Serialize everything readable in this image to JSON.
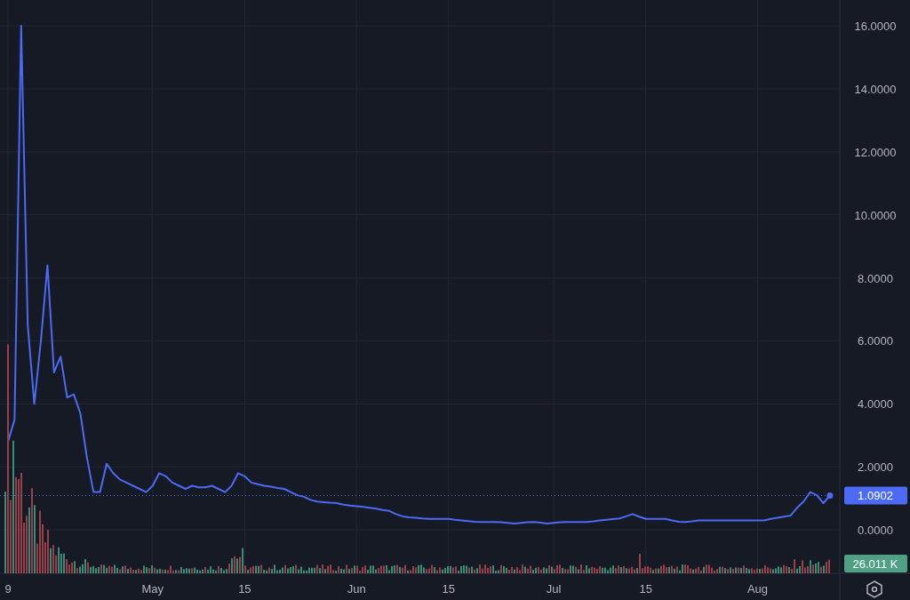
{
  "chart": {
    "chart_data": {
      "type": "line",
      "grid": true,
      "ylim": [
        -1.38,
        16.82
      ],
      "categories": [
        "9",
        null,
        null,
        null,
        null,
        null,
        null,
        null,
        null,
        null,
        null,
        null,
        null,
        null,
        null,
        null,
        null,
        null,
        null,
        null,
        null,
        null,
        "May",
        null,
        null,
        null,
        null,
        null,
        null,
        null,
        null,
        null,
        null,
        null,
        null,
        null,
        "15",
        null,
        null,
        null,
        null,
        null,
        null,
        null,
        null,
        null,
        null,
        null,
        null,
        null,
        null,
        null,
        null,
        "Jun",
        null,
        null,
        null,
        null,
        null,
        null,
        null,
        null,
        null,
        null,
        null,
        null,
        null,
        "15",
        null,
        null,
        null,
        null,
        null,
        null,
        null,
        null,
        null,
        null,
        null,
        null,
        null,
        null,
        null,
        "Jul",
        null,
        null,
        null,
        null,
        null,
        null,
        null,
        null,
        null,
        null,
        null,
        null,
        null,
        "15",
        null,
        null,
        null,
        null,
        null,
        null,
        null,
        null,
        null,
        null,
        null,
        null,
        null,
        null,
        null,
        null,
        "Aug",
        null,
        null,
        null,
        null,
        null,
        null,
        null,
        null,
        null,
        null,
        null
      ],
      "yticks": [
        {
          "value": 0,
          "label": "0.0000"
        },
        {
          "value": 2,
          "label": "2.0000"
        },
        {
          "value": 4,
          "label": "4.0000"
        },
        {
          "value": 6,
          "label": "6.0000"
        },
        {
          "value": 8,
          "label": "8.0000"
        },
        {
          "value": 10,
          "label": "10.0000"
        },
        {
          "value": 12,
          "label": "12.0000"
        },
        {
          "value": 14,
          "label": "14.0000"
        },
        {
          "value": 16,
          "label": "16.0000"
        }
      ],
      "series": [
        {
          "color": "#4d6af5",
          "values": [
            2.8,
            3.5,
            16.0,
            6.5,
            4.0,
            6.0,
            8.4,
            5.0,
            5.5,
            4.2,
            4.3,
            3.7,
            2.3,
            1.2,
            1.2,
            2.1,
            1.8,
            1.6,
            1.5,
            1.4,
            1.3,
            1.2,
            1.4,
            1.8,
            1.7,
            1.5,
            1.4,
            1.3,
            1.4,
            1.35,
            1.35,
            1.4,
            1.3,
            1.2,
            1.4,
            1.8,
            1.7,
            1.5,
            1.45,
            1.4,
            1.37,
            1.33,
            1.3,
            1.2,
            1.1,
            1.05,
            0.95,
            0.9,
            0.88,
            0.86,
            0.85,
            0.8,
            0.77,
            0.75,
            0.73,
            0.7,
            0.67,
            0.63,
            0.6,
            0.5,
            0.43,
            0.4,
            0.38,
            0.36,
            0.35,
            0.35,
            0.35,
            0.35,
            0.32,
            0.3,
            0.28,
            0.26,
            0.25,
            0.25,
            0.25,
            0.24,
            0.22,
            0.2,
            0.22,
            0.24,
            0.25,
            0.23,
            0.2,
            0.22,
            0.24,
            0.25,
            0.25,
            0.25,
            0.25,
            0.27,
            0.3,
            0.32,
            0.34,
            0.36,
            0.43,
            0.5,
            0.42,
            0.35,
            0.35,
            0.35,
            0.35,
            0.3,
            0.26,
            0.25,
            0.27,
            0.3,
            0.3,
            0.3,
            0.3,
            0.3,
            0.3,
            0.3,
            0.3,
            0.3,
            0.3,
            0.3,
            0.35,
            0.38,
            0.42,
            0.45,
            0.7,
            0.9,
            1.2,
            1.1,
            0.85,
            1.09
          ]
        }
      ]
    },
    "price_label": "1.0902",
    "volume_label": "26.011 K"
  }
}
